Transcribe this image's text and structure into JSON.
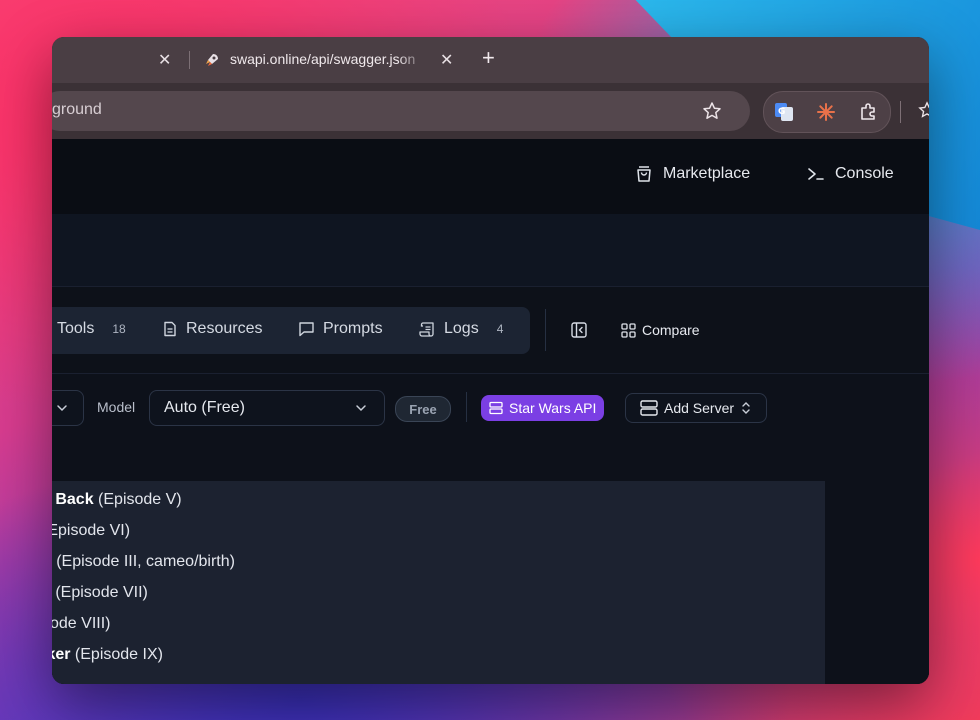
{
  "browser": {
    "tab_title": "swapi.online/api/swagger.json",
    "new_tab_symbol": "+",
    "close_symbol": "✕",
    "address_text": "ground"
  },
  "topnav": {
    "marketplace_label": "Marketplace",
    "console_label": "Console"
  },
  "tabs": [
    {
      "label": "Tools",
      "count": "18"
    },
    {
      "label": "Resources"
    },
    {
      "label": "Prompts"
    },
    {
      "label": "Logs",
      "count": "4"
    }
  ],
  "compare_label": "Compare",
  "model": {
    "label": "Model",
    "value": "Auto (Free)",
    "badge": "Free"
  },
  "servers": {
    "active": "Star Wars API",
    "add_label": "Add Server"
  },
  "chat_lines": [
    {
      "bold": "s Back",
      "rest": " (Episode V)"
    },
    {
      "bold": "",
      "rest": "(Episode VI)"
    },
    {
      "bold": "h",
      "rest": " (Episode III, cameo/birth)"
    },
    {
      "bold": "s",
      "rest": " (Episode VII)"
    },
    {
      "bold": "",
      "rest": "sode VIII)"
    },
    {
      "bold": "lker",
      "rest": " (Episode IX)"
    }
  ],
  "accent_color": "#7b3fe4"
}
